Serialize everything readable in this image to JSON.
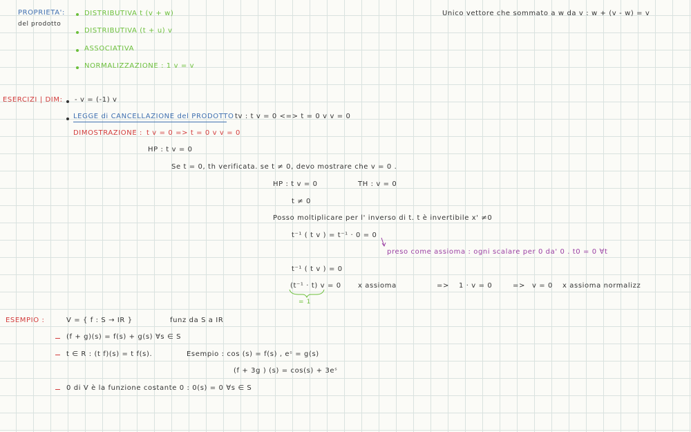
{
  "proprieta": {
    "heading": "PROPRIETA':",
    "subheading": "del prodotto",
    "items": [
      "DISTRIBUTIVA   t (v + w)",
      "DISTRIBUTIVA  (t + u) v",
      "ASSOCIATIVA",
      "NORMALIZZAZIONE : 1 v = v"
    ]
  },
  "top_right_note": "Unico vettore che sommato a w da v : w + (v - w) = v",
  "esercizi": {
    "heading": "ESERCIZI | DIM:",
    "bullet1": "- v = (-1) v",
    "bullet2_label": "LEGGE di CANCELLAZIONE del PRODOTTO",
    "bullet2_rest": "tv :  t v = 0   <=>   t = 0  v  v = 0",
    "dimostrazione_label": "DIMOSTRAZIONE :",
    "dimostrazione_rest": "t v = 0   =>   t = 0  v  v = 0",
    "hp": "HP :   t v = 0",
    "se_line": "Se  t = 0,   th verificata.   se  t ≠ 0,  devo mostrare che  v = 0 .",
    "hp2": "HP :  t v = 0",
    "th2": "TH :  v = 0",
    "t_neq": "t ≠ 0",
    "posso": "Posso moltiplicare per l' inverso di t.   t è invertibile  x' ≠0",
    "step1": "t⁻¹ ( t v )  =  t⁻¹ · 0      = 0",
    "preso": "preso come assioma :  ogni scalare per 0 da' 0 .    t0 = 0  ∀t",
    "step2": "t⁻¹ ( t v ) = 0",
    "step3": "(t⁻¹ · t) v  = 0",
    "step3_note": "x  assioma",
    "arrow1": "=>",
    "one_v": "1 · v  = 0",
    "arrow2": "=>",
    "v_zero": "v = 0",
    "final_note": "x  assioma normalizz",
    "brace_label": "= 1"
  },
  "esempio": {
    "heading": "ESEMPIO :",
    "def": "V = { f : S → IR }",
    "def_note": "funz da  S a IR",
    "line1": "(f + g)(s)  =  f(s)  +  g(s)      ∀s ∈ S",
    "line2a": "t ∈ R :    (t f)(s)  =  t f(s).",
    "line2b": "Esempio :   cos (s)  = f(s) ,    eˢ = g(s)",
    "line3": "(f + 3g ) (s)  =  cos(s)  + 3eˢ",
    "line4": "0  di  V  è la funzione costante  0 :    0(s) = 0   ∀s ∈ S"
  }
}
